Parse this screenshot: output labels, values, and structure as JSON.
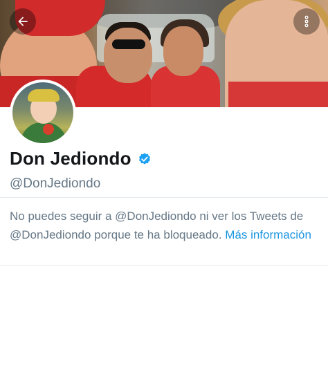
{
  "header": {
    "back_icon": "arrow-left-icon",
    "more_icon": "more-vertical-icon"
  },
  "profile": {
    "display_name": "Don Jediondo",
    "handle": "@DonJediondo",
    "verified_icon": "verified-badge-icon",
    "verified_color": "#1da1f2"
  },
  "blocked_notice": {
    "text": "No puedes seguir a @DonJediondo ni ver los Tweets de @DonJediondo porque te ha bloqueado.",
    "link_label": "Más información",
    "link_color": "#1b95e0"
  }
}
